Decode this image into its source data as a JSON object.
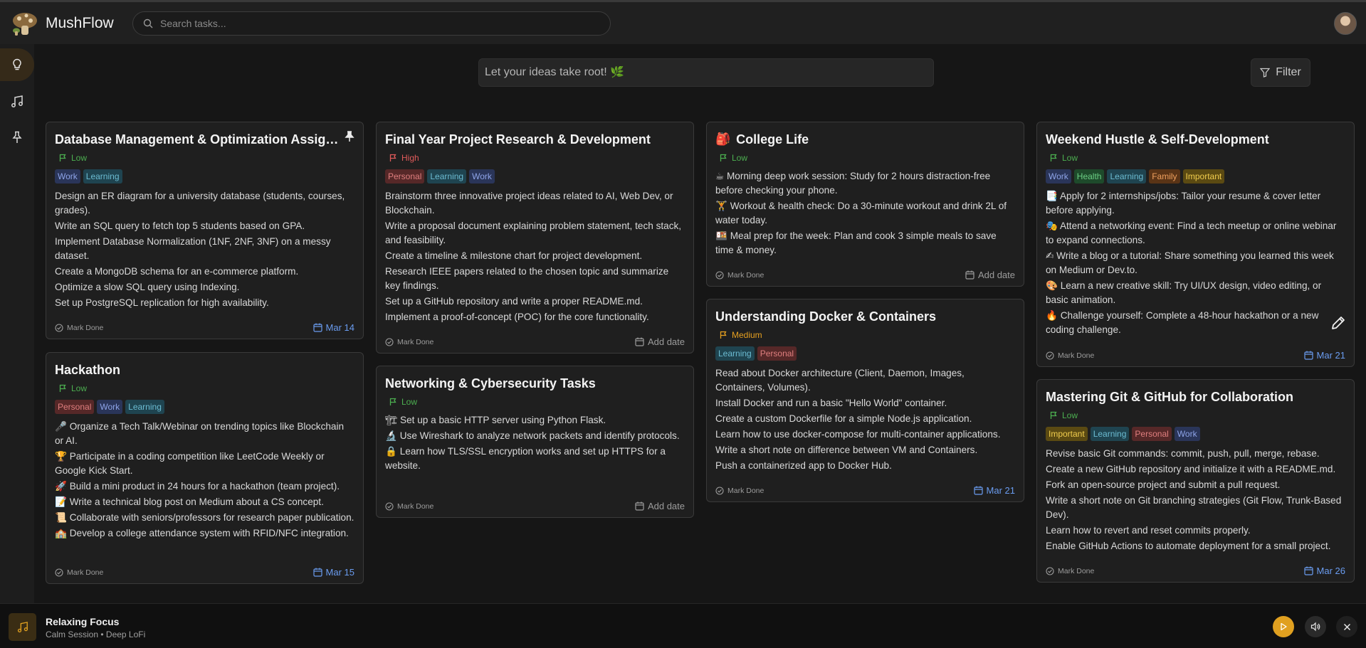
{
  "app": {
    "title": "MushFlow"
  },
  "search": {
    "placeholder": "Search tasks..."
  },
  "idea_input": {
    "placeholder": "Let your ideas take root! 🌿"
  },
  "filter": {
    "label": "Filter"
  },
  "labels": {
    "mark_done": "Mark Done",
    "add_date": "Add date"
  },
  "colors": {
    "accent": "#e0a020",
    "priority_low": "#4caf50",
    "priority_high": "#e05a5a",
    "priority_medium": "#e6a020",
    "due": "#6a9cf0"
  },
  "cards": [
    {
      "title": "Database Management & Optimization Assign…",
      "priority": "Low",
      "pinned": true,
      "tags": [
        {
          "label": "Work",
          "kind": "work"
        },
        {
          "label": "Learning",
          "kind": "learning"
        }
      ],
      "items": [
        "Design an ER diagram for a university database (students, courses, grades).",
        "Write an SQL query to fetch top 5 students based on GPA.",
        "Implement Database Normalization (1NF, 2NF, 3NF) on a messy dataset.",
        "Create a MongoDB schema for an e-commerce platform.",
        "Optimize a slow SQL query using Indexing.",
        "Set up PostgreSQL replication for high availability."
      ],
      "due": "Mar 14"
    },
    {
      "title": "Hackathon",
      "priority": "Low",
      "tags": [
        {
          "label": "Personal",
          "kind": "personal"
        },
        {
          "label": "Work",
          "kind": "work"
        },
        {
          "label": "Learning",
          "kind": "learning"
        }
      ],
      "items": [
        "🎤 Organize a Tech Talk/Webinar on trending topics like Blockchain or AI.",
        "🏆 Participate in a coding competition like LeetCode Weekly or Google Kick Start.",
        "🚀 Build a mini product in 24 hours for a hackathon (team project).",
        "📝 Write a technical blog post on Medium about a CS concept.",
        "📜 Collaborate with seniors/professors for research paper publication.",
        "🏫 Develop a college attendance system with RFID/NFC integration."
      ],
      "due": "Mar 15"
    },
    {
      "title": "Final Year Project Research & Development",
      "priority": "High",
      "tags": [
        {
          "label": "Personal",
          "kind": "personal"
        },
        {
          "label": "Learning",
          "kind": "learning"
        },
        {
          "label": "Work",
          "kind": "work"
        }
      ],
      "items": [
        "Brainstorm three innovative project ideas related to AI, Web Dev, or Blockchain.",
        "Write a proposal document explaining problem statement, tech stack, and feasibility.",
        "Create a timeline & milestone chart for project development.",
        "Research IEEE papers related to the chosen topic and summarize key findings.",
        "Set up a GitHub repository and write a proper README.md.",
        "Implement a proof-of-concept (POC) for the core functionality."
      ],
      "due": ""
    },
    {
      "title": "Networking & Cybersecurity Tasks",
      "priority": "Low",
      "tags": [],
      "items": [
        "🏗 Set up a basic HTTP server using Python Flask.",
        "🔬 Use Wireshark to analyze network packets and identify protocols.",
        "🔒 Learn how TLS/SSL encryption works and set up HTTPS for a website."
      ],
      "due": ""
    },
    {
      "title": "College Life",
      "emoji": "🎒",
      "priority": "Low",
      "tags": [],
      "items": [
        "☕ Morning deep work session: Study for 2 hours distraction-free before checking your phone.",
        "🏋 Workout & health check: Do a 30-minute workout and drink 2L of water today.",
        "🍱 Meal prep for the week: Plan and cook 3 simple meals to save time & money."
      ],
      "due": ""
    },
    {
      "title": "Understanding Docker & Containers",
      "priority": "Medium",
      "tags": [
        {
          "label": "Learning",
          "kind": "learning"
        },
        {
          "label": "Personal",
          "kind": "personal"
        }
      ],
      "items": [
        "Read about Docker architecture (Client, Daemon, Images, Containers, Volumes).",
        "Install Docker and run a basic \"Hello World\" container.",
        "Create a custom Dockerfile for a simple Node.js application.",
        "Learn how to use docker-compose for multi-container applications.",
        "Write a short note on difference between VM and Containers.",
        "Push a containerized app to Docker Hub."
      ],
      "due": "Mar 21"
    },
    {
      "title": "Weekend Hustle & Self-Development",
      "priority": "Low",
      "tags": [
        {
          "label": "Work",
          "kind": "work"
        },
        {
          "label": "Health",
          "kind": "health"
        },
        {
          "label": "Learning",
          "kind": "learning"
        },
        {
          "label": "Family",
          "kind": "family"
        },
        {
          "label": "Important",
          "kind": "important"
        }
      ],
      "items": [
        "📑 Apply for 2 internships/jobs: Tailor your resume & cover letter before applying.",
        "🎭 Attend a networking event: Find a tech meetup or online webinar to expand connections.",
        "✍ Write a blog or a tutorial: Share something you learned this week on Medium or Dev.to.",
        "🎨 Learn a new creative skill: Try UI/UX design, video editing, or basic animation.",
        "🔥 Challenge yourself: Complete a 48-hour hackathon or a new coding challenge."
      ],
      "due": "Mar 21"
    },
    {
      "title": "Mastering Git & GitHub for Collaboration",
      "priority": "Low",
      "tags": [
        {
          "label": "Important",
          "kind": "important"
        },
        {
          "label": "Learning",
          "kind": "learning"
        },
        {
          "label": "Personal",
          "kind": "personal"
        },
        {
          "label": "Work",
          "kind": "work"
        }
      ],
      "items": [
        "Revise basic Git commands: commit, push, pull, merge, rebase.",
        "Create a new GitHub repository and initialize it with a README.md.",
        "Fork an open-source project and submit a pull request.",
        "Write a short note on Git branching strategies (Git Flow, Trunk-Based Dev).",
        "Learn how to revert and reset commits properly.",
        "Enable GitHub Actions to automate deployment for a small project."
      ],
      "due": "Mar 26"
    }
  ],
  "player": {
    "title": "Relaxing Focus",
    "subtitle": "Calm Session • Deep LoFi"
  }
}
